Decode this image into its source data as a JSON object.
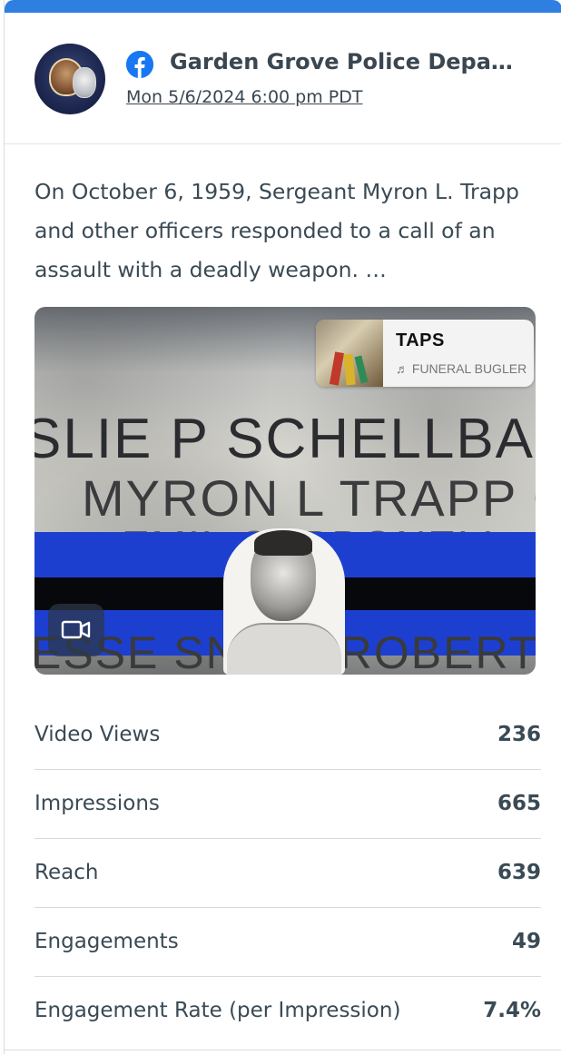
{
  "colors": {
    "accent": "#2f7fe0",
    "facebook_blue": "#1877f2",
    "text": "#3a4a55",
    "divider": "#d6dbde"
  },
  "post": {
    "network_icon": "facebook-icon",
    "page_name": "Garden Grove Police Depa…",
    "date": "Mon 5/6/2024 6:00 pm PDT",
    "text": "On October 6, 1959, Sergeant Myron L. Trapp and other officers responded to a call of an assault with a deadly weapon. …"
  },
  "media": {
    "engraved_lines": [
      "SLIE P SCHELLBACH",
      "MYRON L TRAPP C",
      "EMIL CARBONELL",
      "ESSE SNELL ROBERT"
    ],
    "music": {
      "title": "TAPS",
      "subtitle": "♬ FUNERAL BUGLER"
    },
    "video_icon": "video-camera-icon"
  },
  "stats": [
    {
      "label": "Video Views",
      "value": "236"
    },
    {
      "label": "Impressions",
      "value": "665"
    },
    {
      "label": "Reach",
      "value": "639"
    },
    {
      "label": "Engagements",
      "value": "49"
    },
    {
      "label": "Engagement Rate (per Impression)",
      "value": "7.4%"
    }
  ]
}
